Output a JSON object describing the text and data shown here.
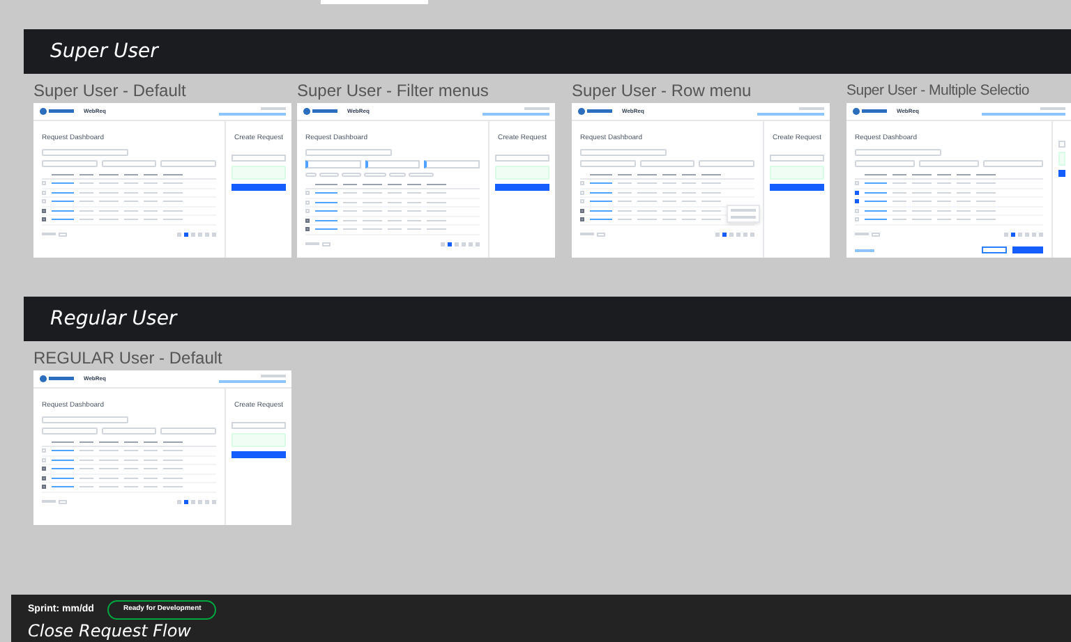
{
  "sections": [
    {
      "title": "Super User",
      "frames": [
        {
          "title": "Super User - Default",
          "kind": "default",
          "app_name": "WebReq",
          "screen_title": "Request Dashboard",
          "side_title": "Create Request",
          "rows": [
            {
              "checked": false
            },
            {
              "checked": false
            },
            {
              "checked": false
            },
            {
              "checked": true
            },
            {
              "checked": true
            }
          ]
        },
        {
          "title": "Super User - Filter menus",
          "kind": "filters",
          "app_name": "WebReq",
          "screen_title": "Request Dashboard",
          "side_title": "Create Request",
          "rows": [
            {
              "checked": false
            },
            {
              "checked": false
            },
            {
              "checked": false
            },
            {
              "checked": true
            },
            {
              "checked": true
            }
          ]
        },
        {
          "title": "Super User - Row menu",
          "kind": "row_menu",
          "app_name": "WebReq",
          "screen_title": "Request Dashboard",
          "side_title": "Create Request",
          "rows": [
            {
              "checked": false
            },
            {
              "checked": false
            },
            {
              "checked": false
            },
            {
              "checked": true
            },
            {
              "checked": true
            }
          ]
        },
        {
          "title": "Super User - Multiple Selectio",
          "kind": "multi_select",
          "app_name": "WebReq",
          "screen_title": "Request Dashboard",
          "rows": [
            {
              "checked": false
            },
            {
              "checked": true
            },
            {
              "checked": true
            },
            {
              "checked": false
            },
            {
              "checked": false
            }
          ]
        }
      ]
    },
    {
      "title": "Regular User",
      "frames": [
        {
          "title": "REGULAR User - Default",
          "kind": "default",
          "app_name": "WebReq",
          "screen_title": "Request Dashboard",
          "side_title": "Create Request",
          "rows": [
            {
              "checked": false
            },
            {
              "checked": false
            },
            {
              "checked": true
            },
            {
              "checked": true
            },
            {
              "checked": true
            }
          ]
        }
      ]
    }
  ],
  "bottom_section": {
    "sprint": "Sprint: mm/dd",
    "status": "Ready for Development",
    "title": "Close Request Flow"
  }
}
